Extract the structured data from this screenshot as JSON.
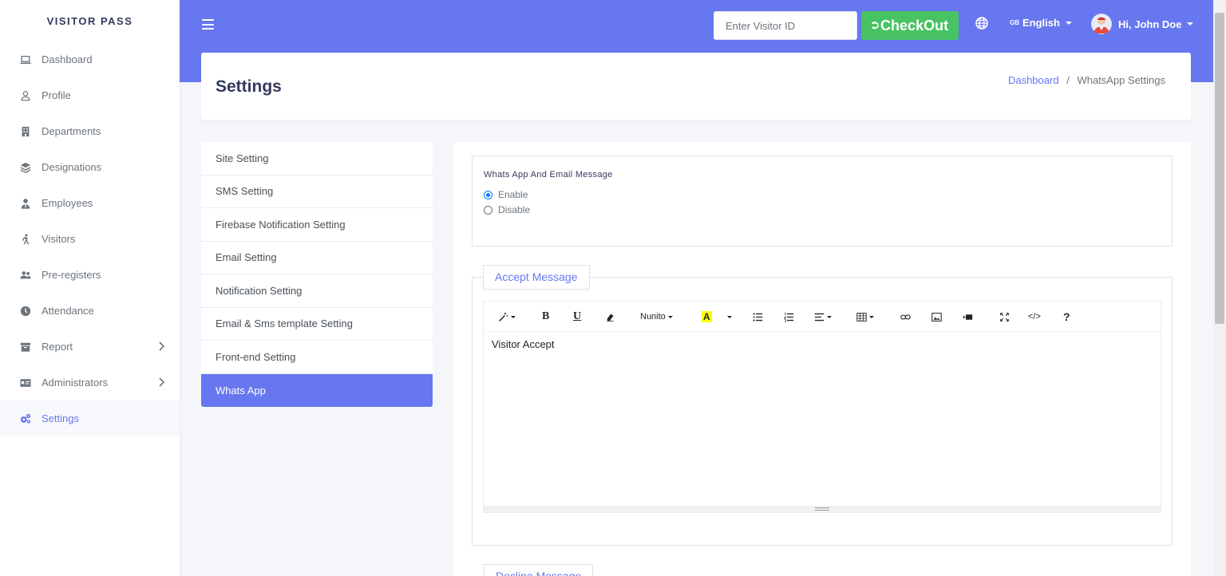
{
  "brand": {
    "title": "VISITOR PASS"
  },
  "sidebar": {
    "items": [
      {
        "label": "Dashboard",
        "icon": "laptop-icon"
      },
      {
        "label": "Profile",
        "icon": "user-icon"
      },
      {
        "label": "Departments",
        "icon": "building-icon"
      },
      {
        "label": "Designations",
        "icon": "layers-icon"
      },
      {
        "label": "Employees",
        "icon": "user-tie-icon"
      },
      {
        "label": "Visitors",
        "icon": "walking-icon"
      },
      {
        "label": "Pre-registers",
        "icon": "users-icon"
      },
      {
        "label": "Attendance",
        "icon": "clock-icon"
      },
      {
        "label": "Report",
        "icon": "archive-icon",
        "has_submenu": true
      },
      {
        "label": "Administrators",
        "icon": "id-card-icon",
        "has_submenu": true
      },
      {
        "label": "Settings",
        "icon": "cogs-icon",
        "active": true
      }
    ]
  },
  "topbar": {
    "visitor_placeholder": "Enter Visitor ID",
    "checkout_label": "CheckOut",
    "language": "English",
    "language_flag": "GB",
    "user_greeting": "Hi, John Doe",
    "color": "#6777ef"
  },
  "header": {
    "title": "Settings",
    "breadcrumb_link": "Dashboard",
    "breadcrumb_sep": "/",
    "breadcrumb_current": "WhatsApp Settings"
  },
  "settings_menu": {
    "items": [
      "Site Setting",
      "SMS Setting",
      "Firebase Notification Setting",
      "Email Setting",
      "Notification Setting",
      "Email & Sms template Setting",
      "Front-end Setting",
      "Whats App"
    ],
    "active": "Whats App"
  },
  "whatsapp": {
    "label": "Whats App And Email Message",
    "options": [
      "Enable",
      "Disable"
    ],
    "selected": "Enable"
  },
  "accept_message": {
    "legend": "Accept Message",
    "font_name": "Nunito",
    "highlight_letter": "A",
    "content": "Visitor Accept",
    "help_glyph": "?",
    "code_glyph": "</>"
  },
  "decline_message": {
    "legend": "Decline Message"
  }
}
